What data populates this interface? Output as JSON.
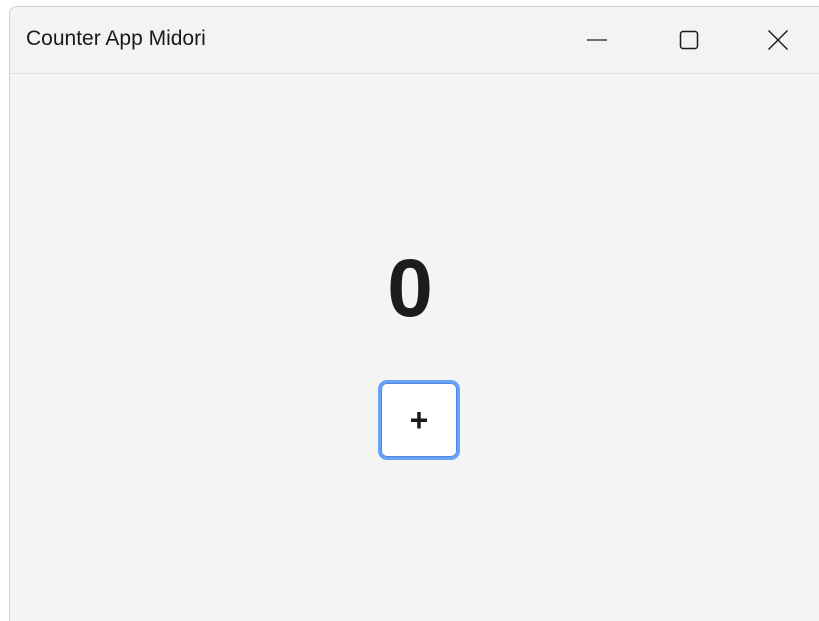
{
  "window": {
    "title": "Counter App Midori",
    "controls": {
      "minimize": "minimize-icon",
      "maximize": "maximize-icon",
      "close": "close-icon"
    }
  },
  "counter": {
    "value": "0",
    "increment_label": "+"
  },
  "colors": {
    "focus_ring": "#6aa3f4",
    "background": "#f4f4f4",
    "text": "#1c1c1c"
  }
}
